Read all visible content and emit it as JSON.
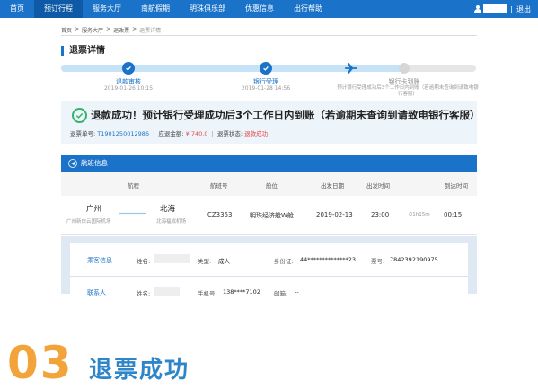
{
  "nav": {
    "items": [
      "首页",
      "预订行程",
      "服务大厅",
      "南航假期",
      "明珠俱乐部",
      "优惠信息",
      "出行帮助"
    ],
    "active_index": 1,
    "logout": "退出",
    "separator": "|"
  },
  "breadcrumb": {
    "home": "首页",
    "sep": ">",
    "service": "服务大厅",
    "refund": "退改票",
    "current": "退票详情"
  },
  "page_title": "退票详情",
  "progress": {
    "fraction": 0.83,
    "steps": [
      {
        "label": "退款审核",
        "time": "2019-01-26 10:15"
      },
      {
        "label": "银行受理",
        "time": "2019-01-28 14:56"
      },
      {
        "label": "银行卡到账",
        "note": "预计银行受理成功后3个工作日内到账（若逾期未查询到请致电银行客服）"
      }
    ]
  },
  "success": {
    "message": "退款成功！预计银行受理成功后3个工作日内到账（若逾期未查询到请致电银行客服）",
    "refund_no_label": "退票单号:",
    "refund_no": "T1901250012986",
    "amount_label": "应退金额:",
    "amount": "¥ 740.0",
    "status_label": "退票状态:",
    "status": "退款成功",
    "sep": "|"
  },
  "flight": {
    "section_title": "航班信息",
    "columns": [
      "航程",
      "航班号",
      "舱位",
      "出发日期",
      "出发时间",
      "到达时间"
    ],
    "row": {
      "from_city": "广州",
      "from_airport": "广州新白云国际机场",
      "to_city": "北海",
      "to_airport": "北海福成机场",
      "flight_no": "CZ3353",
      "cabin": "明珠经济舱W舱",
      "date": "2019-02-13",
      "dep_time": "23:00",
      "duration": "1h15m",
      "arr_time": "00:15"
    }
  },
  "passenger": {
    "section_title": "乘客信息",
    "name_label": "姓名:",
    "type_label": "类型:",
    "type": "成人",
    "id_label": "身份证:",
    "id": "44**************23",
    "ticket_label": "票号:",
    "ticket": "7842392190975",
    "contact_title": "联系人",
    "contact_name_label": "姓名:",
    "phone_label": "手机号:",
    "phone": "138****7102",
    "email_label": "邮箱:",
    "email": "--"
  },
  "caption": {
    "number": "03",
    "text": "退票成功"
  },
  "colors": {
    "brand": "#1a73c8",
    "accent": "#f2a43a",
    "success": "#36b36a",
    "alert": "#e2444a"
  }
}
